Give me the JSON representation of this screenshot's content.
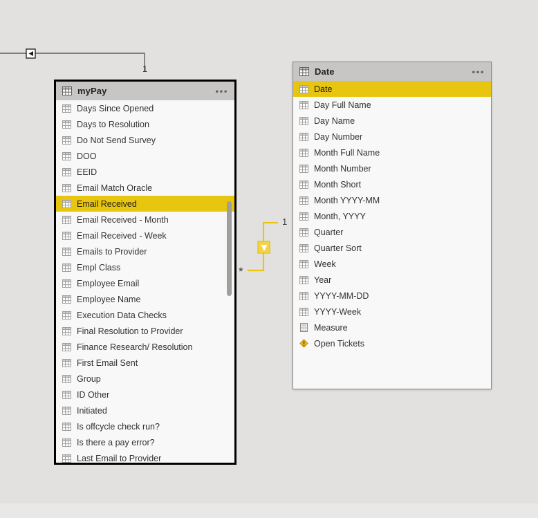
{
  "app": {
    "view": "power-bi-model-view",
    "canvas_bg": "#e2e1df",
    "accent_highlight": "#e8c50f",
    "relationship_line_color": "#e8c50f",
    "inactive_relationship_color": "#605e5c"
  },
  "tables": [
    {
      "name": "myPay",
      "selected": true,
      "header_icon": "table-icon",
      "menu_icon": "ellipsis-icon",
      "scrollbar": true,
      "fields": [
        {
          "label": "Days Since Opened",
          "icon": "table-field-icon",
          "highlight": false
        },
        {
          "label": "Days to Resolution",
          "icon": "table-field-icon",
          "highlight": false
        },
        {
          "label": "Do Not Send Survey",
          "icon": "table-field-icon",
          "highlight": false
        },
        {
          "label": "DOO",
          "icon": "table-field-icon",
          "highlight": false
        },
        {
          "label": "EEID",
          "icon": "table-field-icon",
          "highlight": false
        },
        {
          "label": "Email Match Oracle",
          "icon": "table-field-icon",
          "highlight": false
        },
        {
          "label": "Email Received",
          "icon": "table-field-icon",
          "highlight": true
        },
        {
          "label": "Email Received - Month",
          "icon": "table-field-icon",
          "highlight": false
        },
        {
          "label": "Email Received - Week",
          "icon": "table-field-icon",
          "highlight": false
        },
        {
          "label": "Emails to Provider",
          "icon": "table-field-icon",
          "highlight": false
        },
        {
          "label": "Empl Class",
          "icon": "table-field-icon",
          "highlight": false
        },
        {
          "label": "Employee Email",
          "icon": "table-field-icon",
          "highlight": false
        },
        {
          "label": "Employee Name",
          "icon": "table-field-icon",
          "highlight": false
        },
        {
          "label": "Execution Data Checks",
          "icon": "table-field-icon",
          "highlight": false
        },
        {
          "label": "Final Resolution to Provider",
          "icon": "table-field-icon",
          "highlight": false
        },
        {
          "label": "Finance Research/ Resolution",
          "icon": "table-field-icon",
          "highlight": false
        },
        {
          "label": "First Email Sent",
          "icon": "table-field-icon",
          "highlight": false
        },
        {
          "label": "Group",
          "icon": "table-field-icon",
          "highlight": false
        },
        {
          "label": "ID Other",
          "icon": "table-field-icon",
          "highlight": false
        },
        {
          "label": "Initiated",
          "icon": "table-field-icon",
          "highlight": false
        },
        {
          "label": "Is offcycle check run?",
          "icon": "table-field-icon",
          "highlight": false
        },
        {
          "label": "Is there a pay error?",
          "icon": "table-field-icon",
          "highlight": false
        },
        {
          "label": "Last Email to Provider",
          "icon": "table-field-icon",
          "highlight": false
        }
      ]
    },
    {
      "name": "Date",
      "selected": false,
      "header_icon": "table-icon",
      "menu_icon": "ellipsis-icon",
      "scrollbar": false,
      "fields": [
        {
          "label": "Date",
          "icon": "table-field-icon",
          "highlight": true
        },
        {
          "label": "Day Full Name",
          "icon": "table-field-icon",
          "highlight": false
        },
        {
          "label": "Day Name",
          "icon": "table-field-icon",
          "highlight": false
        },
        {
          "label": "Day Number",
          "icon": "table-field-icon",
          "highlight": false
        },
        {
          "label": "Month Full Name",
          "icon": "table-field-icon",
          "highlight": false
        },
        {
          "label": "Month Number",
          "icon": "table-field-icon",
          "highlight": false
        },
        {
          "label": "Month Short",
          "icon": "table-field-icon",
          "highlight": false
        },
        {
          "label": "Month YYYY-MM",
          "icon": "table-field-icon",
          "highlight": false
        },
        {
          "label": "Month, YYYY",
          "icon": "table-field-icon",
          "highlight": false
        },
        {
          "label": "Quarter",
          "icon": "table-field-icon",
          "highlight": false
        },
        {
          "label": "Quarter Sort",
          "icon": "table-field-icon",
          "highlight": false
        },
        {
          "label": "Week",
          "icon": "table-field-icon",
          "highlight": false
        },
        {
          "label": "Year",
          "icon": "table-field-icon",
          "highlight": false
        },
        {
          "label": "YYYY-MM-DD",
          "icon": "table-field-icon",
          "highlight": false
        },
        {
          "label": "YYYY-Week",
          "icon": "table-field-icon",
          "highlight": false
        },
        {
          "label": "Measure",
          "icon": "measure-calculator-icon",
          "highlight": false
        },
        {
          "label": "Open Tickets",
          "icon": "measure-error-icon",
          "highlight": false
        }
      ]
    }
  ],
  "relationships": [
    {
      "id": "date-to-mypay",
      "style": "active",
      "color": "#e8c50f",
      "from_cardinality": "*",
      "to_cardinality": "1",
      "cross_filter_icon": "filter-direction-arrow-icon"
    },
    {
      "id": "offscreen-to-mypay",
      "style": "inactive",
      "color": "#605e5c",
      "to_cardinality": "1",
      "cross_filter_icon": "filter-direction-arrow-left-icon"
    }
  ]
}
